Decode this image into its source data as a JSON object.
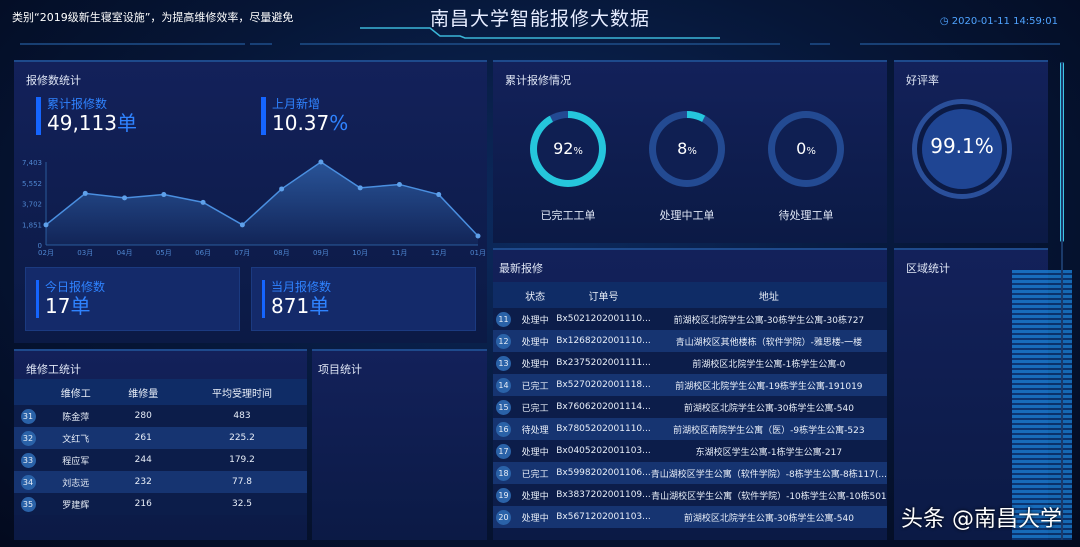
{
  "header": {
    "marquee": "类别“2019级新生寝室设施”，为提高维修效率，尽量避免",
    "title": "南昌大学智能报修大数据",
    "datetime": "2020-01-11 14:59:01"
  },
  "repair_stats": {
    "title": "报修数统计",
    "total_label": "累计报修数",
    "total_value": "49,113",
    "total_unit": "单",
    "growth_label": "上月新增",
    "growth_value": "10.37",
    "growth_unit": "%",
    "today_label": "今日报修数",
    "today_value": "17",
    "today_unit": "单",
    "month_label": "当月报修数",
    "month_value": "871",
    "month_unit": "单"
  },
  "chart_data": {
    "type": "area",
    "categories": [
      "02月",
      "03月",
      "04月",
      "05月",
      "06月",
      "07月",
      "08月",
      "09月",
      "10月",
      "11月",
      "12月",
      "01月"
    ],
    "values": [
      1800,
      4600,
      4200,
      4500,
      3800,
      1800,
      5000,
      7400,
      5100,
      5400,
      4500,
      800
    ],
    "yticks": [
      "0",
      "1,851",
      "3,702",
      "5,552",
      "7,403"
    ],
    "ylim": [
      0,
      7403
    ],
    "color": "#4a8fe0"
  },
  "cumulative": {
    "title": "累计报修情况",
    "items": [
      {
        "label": "已完工工单",
        "value": "92",
        "unit": "%",
        "pct": 92
      },
      {
        "label": "处理中工单",
        "value": "8",
        "unit": "%",
        "pct": 8
      },
      {
        "label": "待处理工单",
        "value": "0",
        "unit": "%",
        "pct": 0
      }
    ]
  },
  "rating": {
    "title": "好评率",
    "value": "99.1%"
  },
  "region": {
    "title": "区域统计"
  },
  "project": {
    "title": "项目统计"
  },
  "workers": {
    "title": "维修工统计",
    "headers": [
      "维修工",
      "维修量",
      "平均受理时间"
    ],
    "rows": [
      {
        "no": "31",
        "name": "陈金萍",
        "count": "280",
        "time": "483"
      },
      {
        "no": "32",
        "name": "文红飞",
        "count": "261",
        "time": "225.2"
      },
      {
        "no": "33",
        "name": "程应军",
        "count": "244",
        "time": "179.2"
      },
      {
        "no": "34",
        "name": "刘志远",
        "count": "232",
        "time": "77.8"
      },
      {
        "no": "35",
        "name": "罗建辉",
        "count": "216",
        "time": "32.5"
      }
    ]
  },
  "latest": {
    "title": "最新报修",
    "headers": [
      "状态",
      "订单号",
      "地址"
    ],
    "rows": [
      {
        "no": "11",
        "status": "处理中",
        "order": "Bx5021202001110...",
        "addr": "前湖校区北院学生公寓-30栋学生公寓-30栋727"
      },
      {
        "no": "12",
        "status": "处理中",
        "order": "Bx1268202001110...",
        "addr": "青山湖校区其他楼栋（软件学院）-雅思楼-一楼"
      },
      {
        "no": "13",
        "status": "处理中",
        "order": "Bx2375202001111...",
        "addr": "前湖校区北院学生公寓-1栋学生公寓-0"
      },
      {
        "no": "14",
        "status": "已完工",
        "order": "Bx5270202001118...",
        "addr": "前湖校区北院学生公寓-19栋学生公寓-191019"
      },
      {
        "no": "15",
        "status": "已完工",
        "order": "Bx7606202001114...",
        "addr": "前湖校区北院学生公寓-30栋学生公寓-540"
      },
      {
        "no": "16",
        "status": "待处理",
        "order": "Bx7805202001110...",
        "addr": "前湖校区南院学生公寓（医）-9栋学生公寓-523"
      },
      {
        "no": "17",
        "status": "处理中",
        "order": "Bx0405202001103...",
        "addr": "东湖校区学生公寓-1栋学生公寓-217"
      },
      {
        "no": "18",
        "status": "已完工",
        "order": "Bx5998202001106...",
        "addr": "青山湖校区学生公寓（软件学院）-8栋学生公寓-8栋117(..."
      },
      {
        "no": "19",
        "status": "处理中",
        "order": "Bx3837202001109...",
        "addr": "青山湖校区学生公寓（软件学院）-10栋学生公寓-10栋501"
      },
      {
        "no": "20",
        "status": "处理中",
        "order": "Bx5671202001103...",
        "addr": "前湖校区北院学生公寓-30栋学生公寓-540"
      }
    ]
  },
  "watermark": "头条 @南昌大学"
}
